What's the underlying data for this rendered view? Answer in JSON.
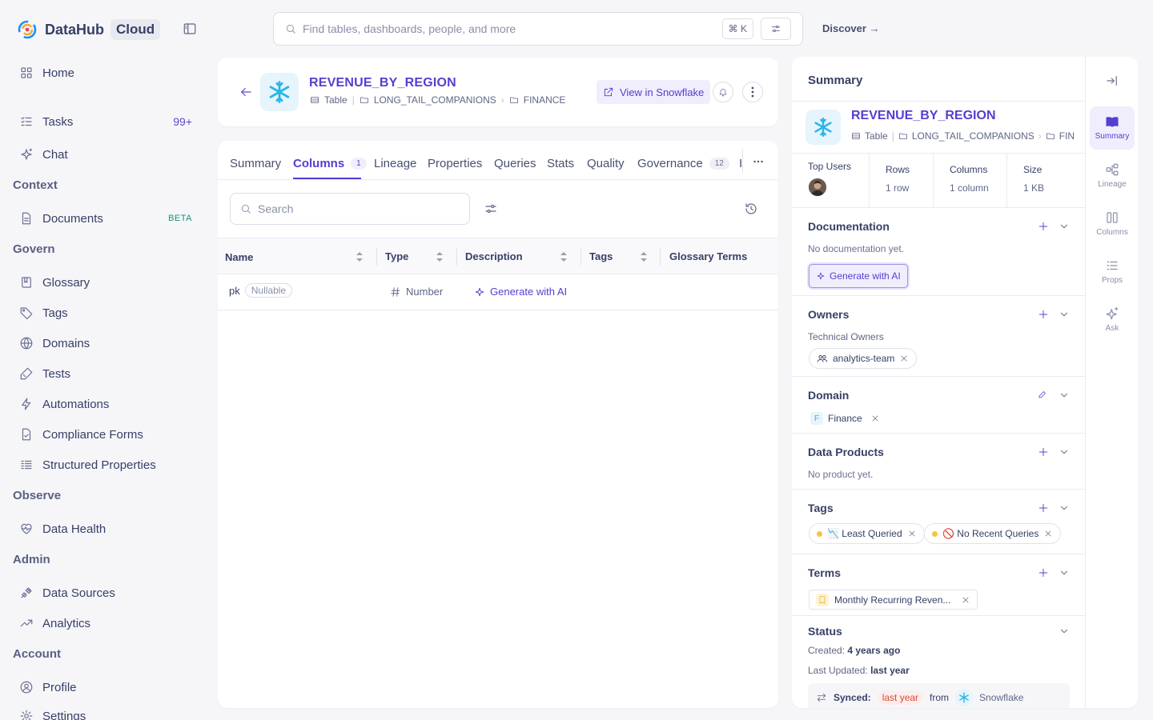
{
  "app": {
    "name": "DataHub",
    "edition": "Cloud"
  },
  "sidebar": {
    "items": [
      {
        "label": "Home",
        "icon": "grid-icon"
      },
      {
        "label": "Tasks",
        "icon": "tasks-icon",
        "badge": "99+"
      },
      {
        "label": "Chat",
        "icon": "sparkle-icon"
      },
      {
        "label": "Documents",
        "icon": "document-icon",
        "badge": "BETA"
      },
      {
        "label": "Glossary",
        "icon": "book-icon"
      },
      {
        "label": "Tags",
        "icon": "tag-icon"
      },
      {
        "label": "Domains",
        "icon": "globe-icon"
      },
      {
        "label": "Tests",
        "icon": "test-icon"
      },
      {
        "label": "Automations",
        "icon": "lightning-icon"
      },
      {
        "label": "Compliance Forms",
        "icon": "form-icon"
      },
      {
        "label": "Structured Properties",
        "icon": "list-icon"
      },
      {
        "label": "Data Health",
        "icon": "heart-icon"
      },
      {
        "label": "Data Sources",
        "icon": "plug-icon"
      },
      {
        "label": "Analytics",
        "icon": "chart-icon"
      },
      {
        "label": "Profile",
        "icon": "user-icon"
      },
      {
        "label": "Settings",
        "icon": "gear-icon"
      }
    ],
    "sections": [
      "Context",
      "Govern",
      "Observe",
      "Admin",
      "Account"
    ]
  },
  "search": {
    "placeholder": "Find tables, dashboards, people, and more",
    "shortcut": "⌘ K"
  },
  "discover_label": "Discover →",
  "entity": {
    "name": "REVENUE_BY_REGION",
    "type": "Table",
    "container": "LONG_TAIL_COMPANIONS",
    "schema": "FINANCE",
    "view_button": "View in Snowflake"
  },
  "tabs": [
    {
      "label": "Summary"
    },
    {
      "label": "Columns",
      "count": "1",
      "active": true
    },
    {
      "label": "Lineage"
    },
    {
      "label": "Properties"
    },
    {
      "label": "Queries"
    },
    {
      "label": "Stats"
    },
    {
      "label": "Quality"
    },
    {
      "label": "Governance",
      "count": "12"
    },
    {
      "label": "I"
    }
  ],
  "columns_view": {
    "search_placeholder": "Search",
    "headers": [
      "Name",
      "Type",
      "Description",
      "Tags",
      "Glossary Terms"
    ],
    "rows": [
      {
        "name": "pk",
        "nullable": "Nullable",
        "type": "Number",
        "description_action": "Generate with AI"
      }
    ]
  },
  "summary": {
    "title": "Summary",
    "entity_name": "REVENUE_BY_REGION",
    "type": "Table",
    "container": "LONG_TAIL_COMPANIONS",
    "schema_truncated": "FIN",
    "stats": {
      "top_users_label": "Top Users",
      "rows_label": "Rows",
      "rows_value": "1 row",
      "columns_label": "Columns",
      "columns_value": "1 column",
      "size_label": "Size",
      "size_value": "1 KB"
    },
    "documentation": {
      "title": "Documentation",
      "empty": "No documentation yet.",
      "button": "Generate with AI"
    },
    "owners": {
      "title": "Owners",
      "subtitle": "Technical Owners",
      "owner": "analytics-team"
    },
    "domain": {
      "title": "Domain",
      "letter": "F",
      "value": "Finance"
    },
    "data_products": {
      "title": "Data Products",
      "empty": "No product yet."
    },
    "tags": {
      "title": "Tags",
      "items": [
        "📉 Least Queried",
        "🚫 No Recent Queries"
      ]
    },
    "terms": {
      "title": "Terms",
      "item": "Monthly Recurring Reven..."
    },
    "status": {
      "title": "Status",
      "created_label": "Created:",
      "created_value": "4 years ago",
      "updated_label": "Last Updated:",
      "updated_value": "last year",
      "synced_label": "Synced:",
      "synced_value": "last year",
      "from_label": "from",
      "source": "Snowflake"
    }
  },
  "rail": [
    {
      "label": "Summary",
      "active": true
    },
    {
      "label": "Lineage"
    },
    {
      "label": "Columns"
    },
    {
      "label": "Props"
    },
    {
      "label": "Ask"
    }
  ],
  "colors": {
    "accent": "#533fd1",
    "snowflake": "#29b5e8"
  }
}
